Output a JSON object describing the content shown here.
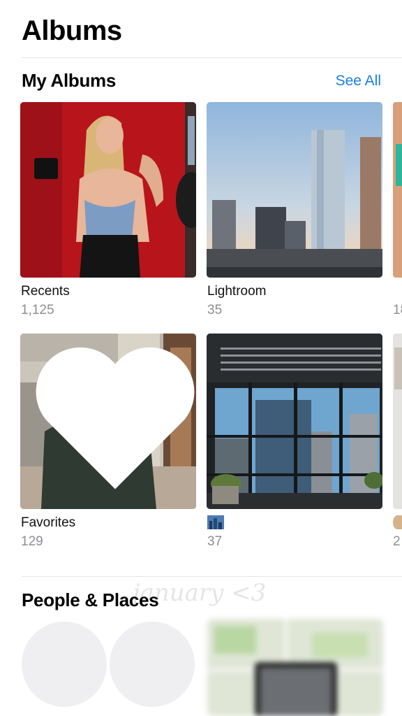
{
  "header": {
    "title": "Albums"
  },
  "my_albums": {
    "title": "My Albums",
    "see_all_label": "See All",
    "albums": [
      {
        "name": "Recents",
        "count": "1,125"
      },
      {
        "name": "Lightroom",
        "count": "35"
      },
      {
        "name": "Favorites",
        "count": "129"
      },
      {
        "name": "",
        "count": "37"
      }
    ],
    "peek_counts": [
      "18",
      "2"
    ]
  },
  "people_places": {
    "title": "People & Places"
  },
  "overlay": {
    "caption": "january <3"
  },
  "colors": {
    "accent": "#1a7ce6",
    "secondary_text": "#8e8e93",
    "divider": "#e4e4e6"
  }
}
